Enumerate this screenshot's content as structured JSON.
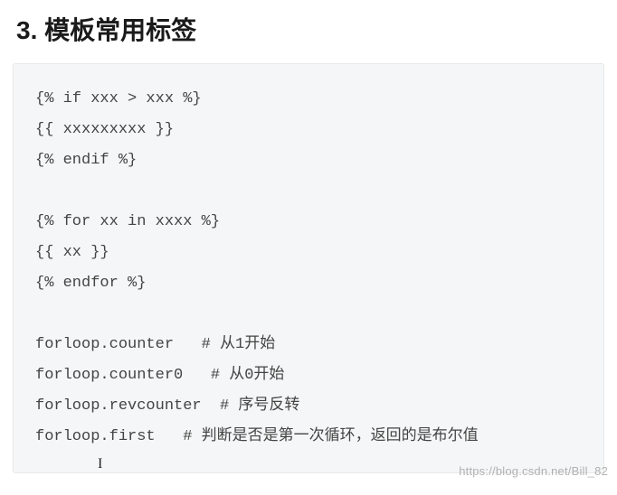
{
  "heading": "3. 模板常用标签",
  "code": {
    "lines": [
      "{% if xxx > xxx %}",
      "{{ xxxxxxxxx }}",
      "{% endif %}",
      "",
      "{% for xx in xxxx %}",
      "{{ xx }}",
      "{% endfor %}",
      "",
      "forloop.counter   # 从1开始",
      "forloop.counter0   # 从0开始",
      "forloop.revcounter  # 序号反转",
      "forloop.first   # 判断是否是第一次循环，返回的是布尔值"
    ]
  },
  "watermark": "https://blog.csdn.net/Bill_82"
}
